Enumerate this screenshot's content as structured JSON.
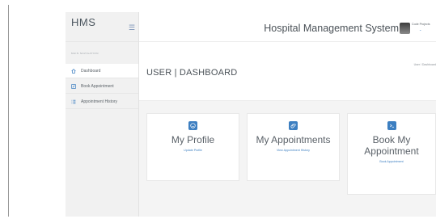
{
  "sidebar": {
    "brand": "HMS",
    "nav_heading": "MAIN NAVIGATION",
    "items": [
      {
        "label": "Dashboard",
        "icon": "home-icon"
      },
      {
        "label": "Book Appointment",
        "icon": "edit-icon"
      },
      {
        "label": "Appointment History",
        "icon": "list-icon"
      }
    ]
  },
  "header": {
    "title": "Hospital Management System",
    "user_name": "Code Projects"
  },
  "page": {
    "title": "USER | DASHBOARD",
    "breadcrumb": "User / Dashboard"
  },
  "cards": [
    {
      "title": "My Profile",
      "link": "Update Profile",
      "icon": "smile-icon"
    },
    {
      "title": "My Appointments",
      "link": "View Appointment History",
      "icon": "paperclip-icon"
    },
    {
      "title": "Book My Appointment",
      "link": "Book Appointment",
      "icon": "terminal-icon"
    }
  ],
  "colors": {
    "accent": "#3d7fc1",
    "sidebar_bg": "#f1f1f1",
    "content_bg": "#f4f4f4"
  }
}
